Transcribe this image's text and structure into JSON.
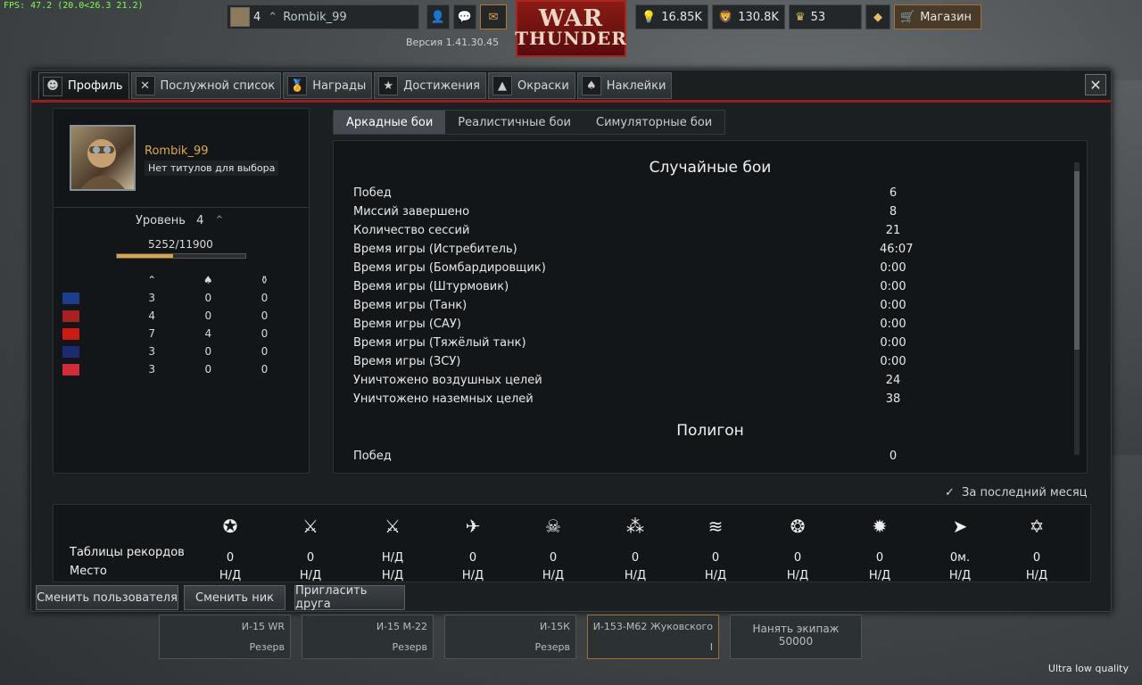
{
  "fps": "FPS: 47.2 (20.0<26.3 21.2)",
  "quality": "Ultra low quality",
  "top": {
    "level": "4",
    "username": "Rombik_99",
    "shop_label": "Магазин",
    "lions": "16.85K",
    "silver": "130.8K",
    "gold": "53",
    "version": "Версия 1.41.30.45",
    "logo_line1": "WAR",
    "logo_line2": "THUNDER"
  },
  "tabs": [
    "Профиль",
    "Послужной список",
    "Награды",
    "Достижения",
    "Окраски",
    "Наклейки"
  ],
  "profile": {
    "name": "Rombik_99",
    "title": "Нет титулов для выбора",
    "level_label": "Уровень",
    "level": "4",
    "exp": "5252/11900",
    "exp_fraction": 0.44,
    "countries": [
      {
        "name": "USA",
        "flag": "#1c3c8c",
        "a": "3",
        "b": "0",
        "c": "0"
      },
      {
        "name": "Germany",
        "flag": "#a82020",
        "a": "4",
        "b": "0",
        "c": "0"
      },
      {
        "name": "USSR",
        "flag": "#cc1a10",
        "a": "7",
        "b": "4",
        "c": "0"
      },
      {
        "name": "Britain",
        "flag": "#1d2a6e",
        "a": "3",
        "b": "0",
        "c": "0"
      },
      {
        "name": "Japan",
        "flag": "#d42a3a",
        "a": "3",
        "b": "0",
        "c": "0"
      }
    ]
  },
  "subtabs": [
    "Аркадные бои",
    "Реалистичные бои",
    "Симуляторные бои"
  ],
  "stats": {
    "section1": "Случайные бои",
    "rows": [
      {
        "label": "Побед",
        "value": "6"
      },
      {
        "label": "Миссий завершено",
        "value": "8"
      },
      {
        "label": "Количество сессий",
        "value": "21"
      },
      {
        "label": "Время игры (Истребитель)",
        "value": "46:07"
      },
      {
        "label": "Время игры (Бомбардировщик)",
        "value": "0:00"
      },
      {
        "label": "Время игры (Штурмовик)",
        "value": "0:00"
      },
      {
        "label": "Время игры (Танк)",
        "value": "0:00"
      },
      {
        "label": "Время игры (САУ)",
        "value": "0:00"
      },
      {
        "label": "Время игры (Тяжёлый танк)",
        "value": "0:00"
      },
      {
        "label": "Время игры (ЗСУ)",
        "value": "0:00"
      },
      {
        "label": "Уничтожено воздушных целей",
        "value": "24"
      },
      {
        "label": "Уничтожено наземных целей",
        "value": "38"
      }
    ],
    "section2": "Полигон",
    "row2_label": "Побед",
    "row2_value": "0"
  },
  "leaderboard": {
    "month_label": "За последний месяц",
    "row1_label": "Таблицы рекордов",
    "row2_label": "Место",
    "cols": [
      {
        "icon": "star-badge-icon",
        "v1": "0",
        "v2": "Н/Д"
      },
      {
        "icon": "crossed-swords-icon",
        "v1": "0",
        "v2": "Н/Д"
      },
      {
        "icon": "crossed-swords-star-icon",
        "v1": "Н/Д",
        "v2": "Н/Д"
      },
      {
        "icon": "plane-icon",
        "v1": "0",
        "v2": "Н/Д"
      },
      {
        "icon": "skull-icon",
        "v1": "0",
        "v2": "Н/Д"
      },
      {
        "icon": "three-stars-icon",
        "v1": "0",
        "v2": "Н/Д"
      },
      {
        "icon": "planes-formation-icon",
        "v1": "0",
        "v2": "Н/Д"
      },
      {
        "icon": "lion-icon",
        "v1": "0",
        "v2": "Н/Д"
      },
      {
        "icon": "lightbulb-icon",
        "v1": "0",
        "v2": "Н/Д"
      },
      {
        "icon": "arrow-badge-icon",
        "v1": "0м.",
        "v2": "Н/Д"
      },
      {
        "icon": "star-of-david-icon",
        "v1": "0",
        "v2": "Н/Д"
      }
    ]
  },
  "footer": [
    "Сменить пользователя",
    "Сменить ник",
    "Пригласить друга"
  ],
  "hangar": [
    {
      "name": "И-15 WR",
      "status": "Резерв"
    },
    {
      "name": "И-15 М-22",
      "status": "Резерв"
    },
    {
      "name": "И-15К",
      "status": "Резерв"
    },
    {
      "name": "И-153-М62 Жуковского",
      "status": "I"
    }
  ],
  "hire_crew": "Нанять экипаж",
  "hire_cost": "50000"
}
